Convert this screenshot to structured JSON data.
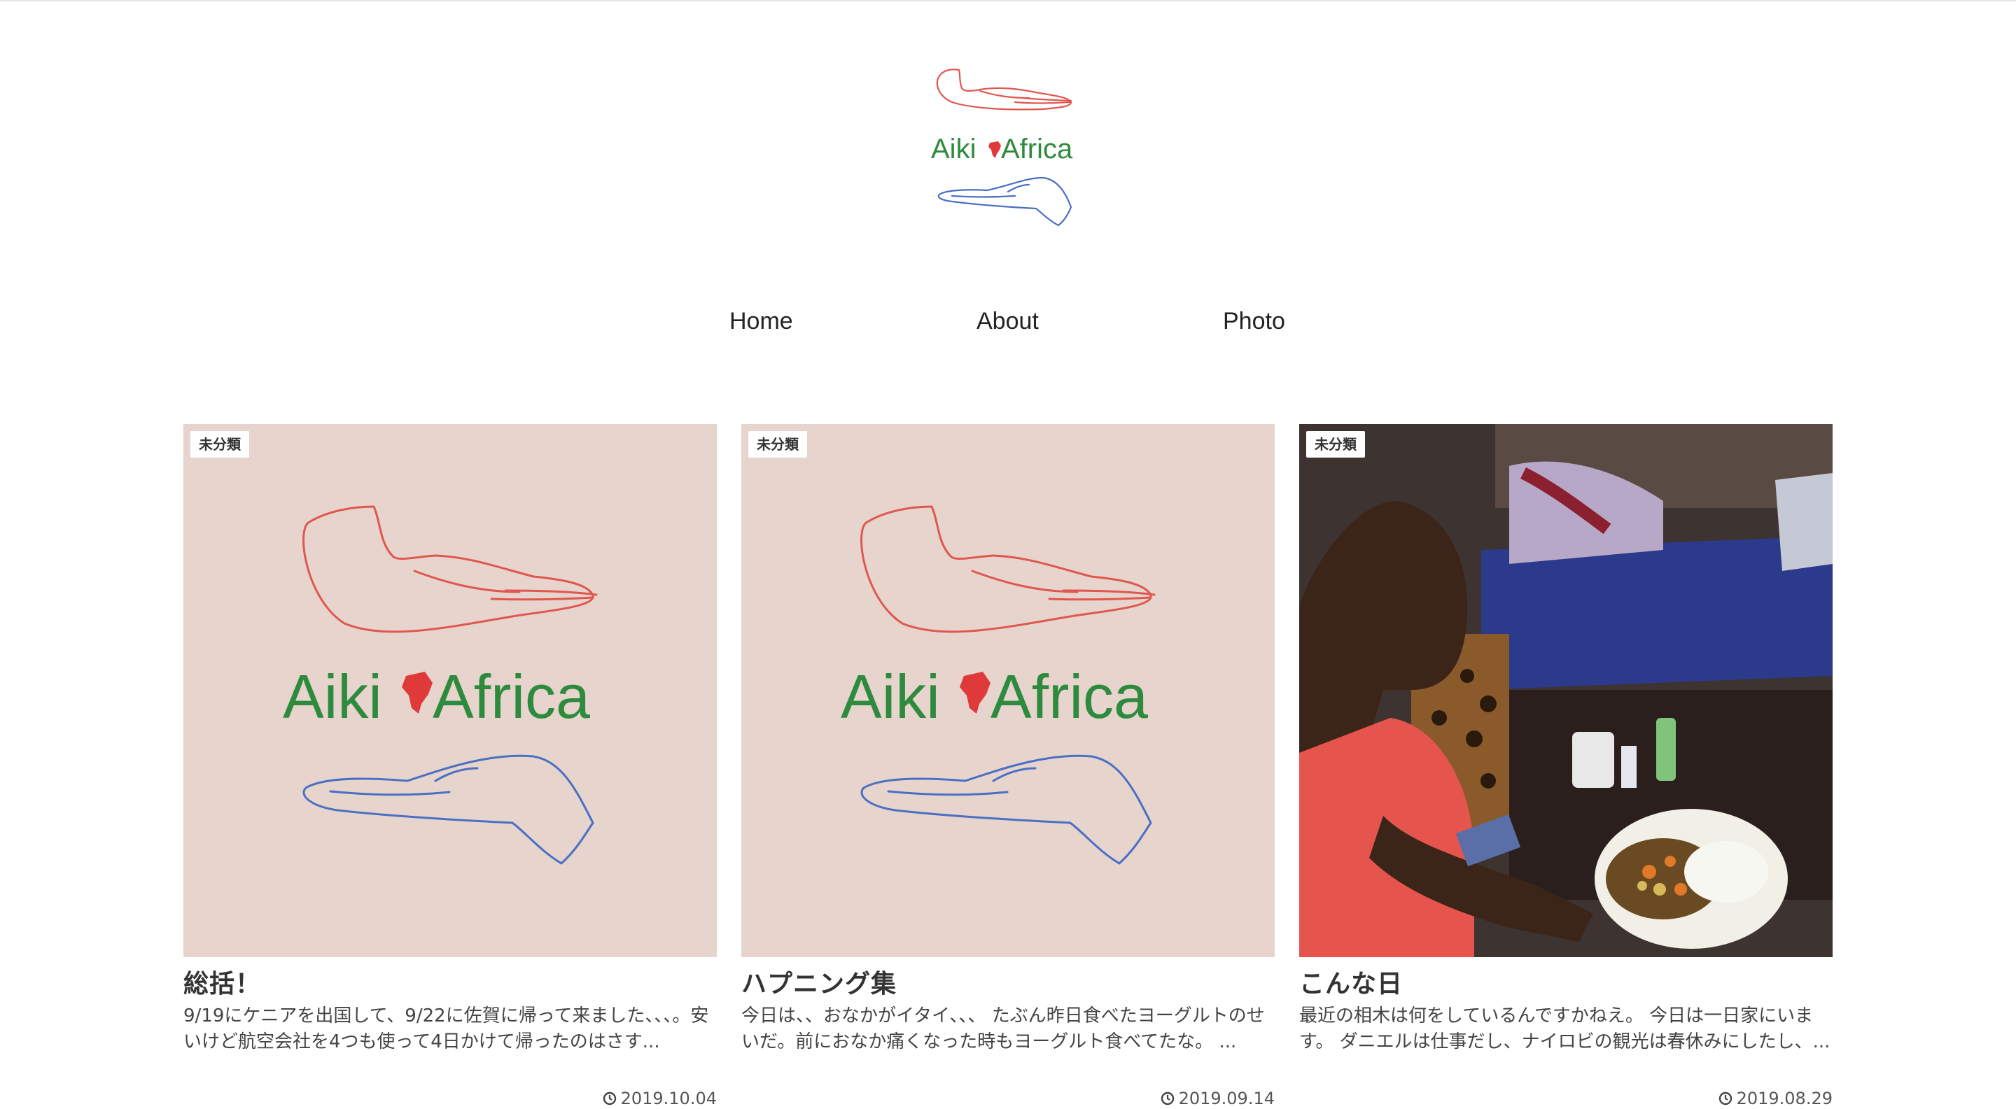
{
  "site": {
    "logo_text": "Aiki Africa",
    "logo_word_left": "Aiki",
    "logo_word_right": "Africa"
  },
  "nav": {
    "items": [
      {
        "label": "Home"
      },
      {
        "label": "About"
      },
      {
        "label": "Photo"
      }
    ]
  },
  "posts": [
    {
      "category": "未分類",
      "title": "総括！",
      "excerpt": "9/19にケニアを出国して、9/22に佐賀に帰って来ました、、、。安いけど航空会社を4つも使って4日かけて帰ったのはさす...",
      "date": "2019.10.04",
      "thumbnail": "aiki-africa-logo"
    },
    {
      "category": "未分類",
      "title": "ハプニング集",
      "excerpt": "今日は、、おなかがイタイ、、、 たぶん昨日食べたヨーグルトのせいだ。前におなか痛くなった時もヨーグルト食べてたな。 ...",
      "date": "2019.09.14",
      "thumbnail": "aiki-africa-logo"
    },
    {
      "category": "未分類",
      "title": "こんな日",
      "excerpt": "最近の相木は何をしているんですかねえ。 今日は一日家にいます。 ダニエルは仕事だし、ナイロビの観光は春休みにしたし、...",
      "date": "2019.08.29",
      "thumbnail": "photo-man-eating-curry"
    }
  ],
  "colors": {
    "brand_green": "#2e8b3e",
    "brand_red": "#e0393a",
    "hand_red": "#e0574f",
    "hand_blue": "#4a6fc4",
    "thumb_bg": "#e6d4cd"
  },
  "icons": {
    "date": "clock-icon",
    "logo_map": "africa-map-icon",
    "hands": "hands-icon"
  }
}
